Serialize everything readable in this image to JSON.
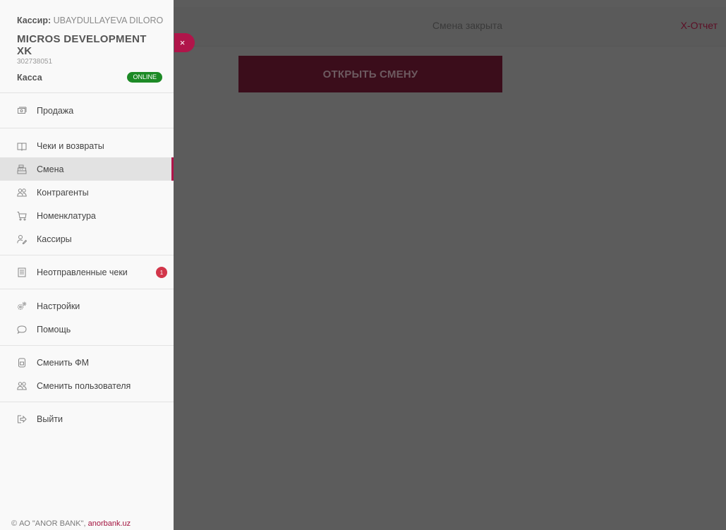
{
  "sidebar": {
    "cashier_label": "Кассир:",
    "cashier_name": "UBAYDULLAYEVA DILOROMX",
    "company": "MICROS DEVELOPMENT XK",
    "inn": "302738051",
    "kassa_label": "Касса",
    "status": "ONLINE",
    "menu": {
      "sale": "Продажа",
      "receipts": "Чеки и возвраты",
      "shift": "Смена",
      "contractors": "Контрагенты",
      "nomenclature": "Номенклатура",
      "cashiers": "Кассиры",
      "unsent": "Неотправленные чеки",
      "unsent_count": "1",
      "settings": "Настройки",
      "help": "Помощь",
      "change_fm": "Сменить ФМ",
      "change_user": "Сменить пользователя",
      "logout": "Выйти"
    },
    "footer_text": "© АО \"ANOR BANK\",",
    "footer_link": "anorbank.uz"
  },
  "close_icon": "×",
  "topbar": {
    "status": "Смена закрыта",
    "xreport": "X-Отчет"
  },
  "main": {
    "open_shift_button": "ОТКРЫТЬ СМЕНУ"
  },
  "colors": {
    "accent": "#b0154a",
    "online": "#1d8a26",
    "badge": "#d2364a"
  }
}
